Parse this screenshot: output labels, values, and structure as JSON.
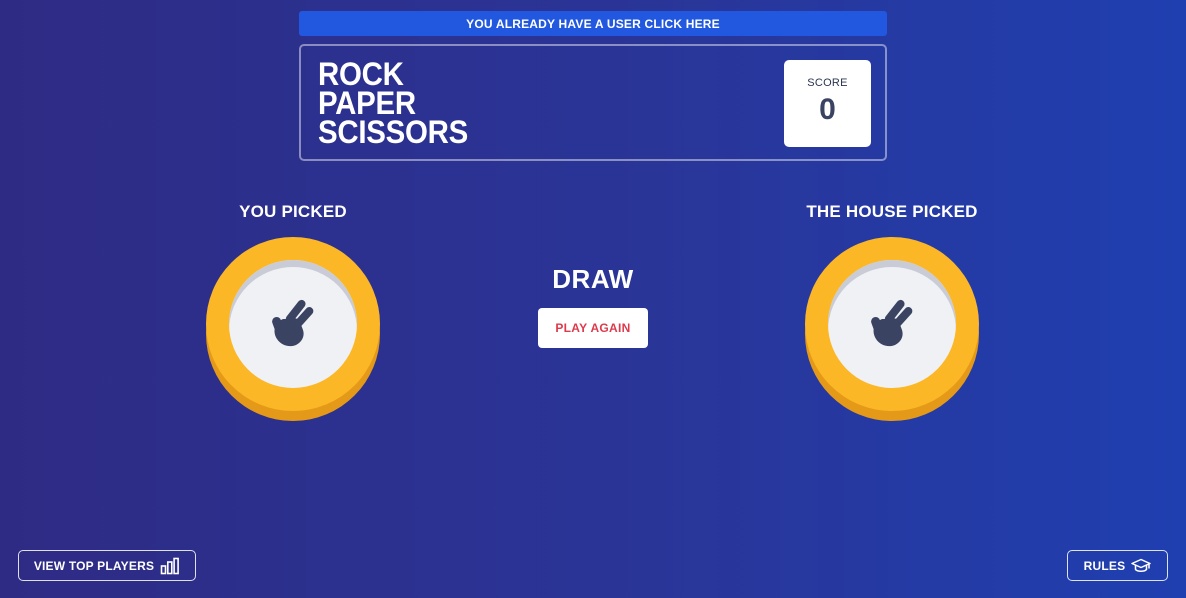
{
  "banner": {
    "text": "YOU ALREADY HAVE A USER CLICK HERE"
  },
  "header": {
    "title_lines": [
      "ROCK",
      "PAPER",
      "SCISSORS"
    ],
    "score_label": "SCORE",
    "score_value": "0"
  },
  "game": {
    "you_label": "YOU PICKED",
    "house_label": "THE HOUSE PICKED",
    "you_pick_icon": "scissors-hand-icon",
    "house_pick_icon": "scissors-hand-icon",
    "result": "DRAW",
    "play_again_label": "PLAY AGAIN"
  },
  "footer": {
    "top_players_label": "VIEW TOP PLAYERS",
    "top_players_icon": "bar-chart-icon",
    "rules_label": "RULES",
    "rules_icon": "graduation-cap-icon"
  },
  "colors": {
    "background_start": "#2e2b84",
    "background_end": "#1f3fb0",
    "banner": "#2158df",
    "token_ring": "#fbb725",
    "token_shadow": "#e49a18",
    "play_again_text": "#dd3a4c"
  }
}
